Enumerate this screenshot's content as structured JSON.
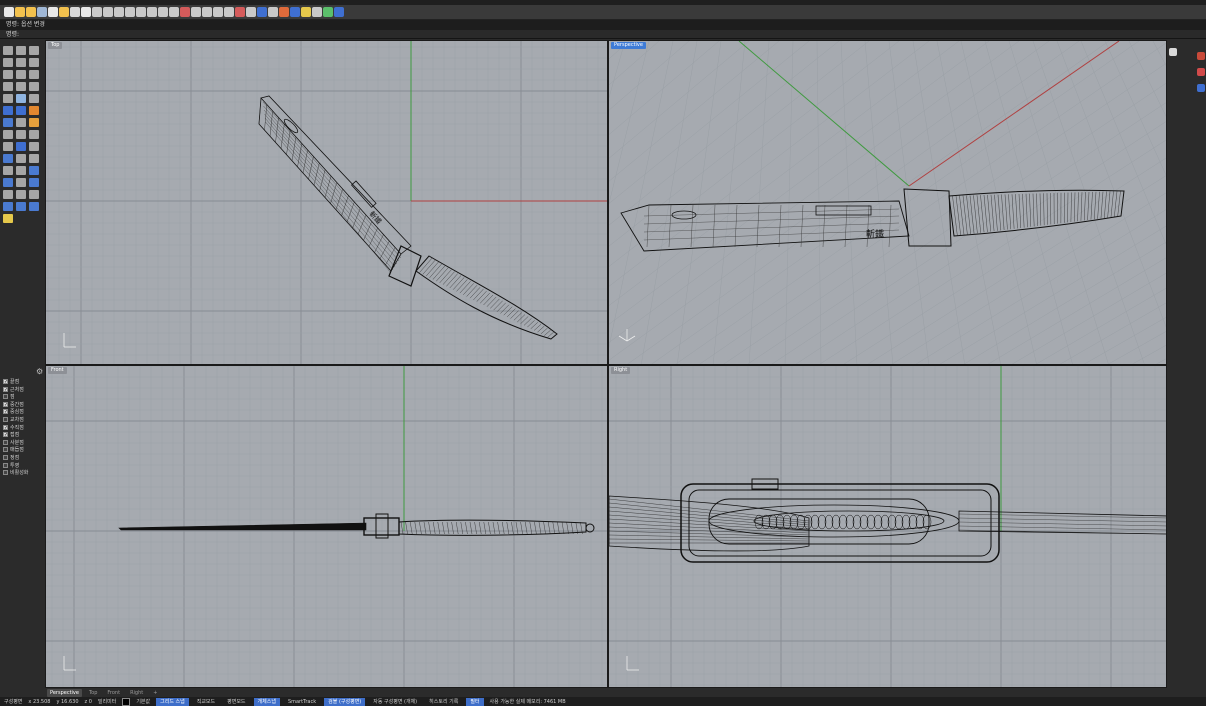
{
  "command_history": "명령: 옵션 변경",
  "command_prompt": "명령:",
  "viewports": {
    "top": "Top",
    "perspective": "Perspective",
    "front": "Front",
    "right": "Right"
  },
  "osnaps": [
    {
      "label": "끝점",
      "on": true
    },
    {
      "label": "근처점",
      "on": true
    },
    {
      "label": "점",
      "on": false
    },
    {
      "label": "중간점",
      "on": true
    },
    {
      "label": "중심점",
      "on": true
    },
    {
      "label": "교차점",
      "on": false
    },
    {
      "label": "수직점",
      "on": true
    },
    {
      "label": "접점",
      "on": true
    },
    {
      "label": "사분점",
      "on": false
    },
    {
      "label": "매듭점",
      "on": false
    },
    {
      "label": "정점",
      "on": false
    },
    {
      "label": "투영",
      "on": false
    },
    {
      "label": "비활성화",
      "on": false
    }
  ],
  "bottom_tabs": [
    "Perspective",
    "Top",
    "Front",
    "Right"
  ],
  "status": {
    "cplane": "구성평면",
    "x": "x 23.508",
    "y": "y 16.630",
    "z": "z 0",
    "units": "밀리미터",
    "layer": "기본값",
    "buttons": [
      {
        "label": "그리드 스냅",
        "on": true
      },
      {
        "label": "직교모드",
        "on": false
      },
      {
        "label": "평면모드",
        "on": false
      },
      {
        "label": "개체스냅",
        "on": true
      },
      {
        "label": "SmartTrack",
        "on": false
      },
      {
        "label": "검볼 (구성평면)",
        "on": true
      },
      {
        "label": "자동 구성평면 (개체)",
        "on": false
      },
      {
        "label": "히스토리 기록",
        "on": false
      },
      {
        "label": "필터",
        "on": true
      }
    ],
    "memory": "사용 가능한 실제 메모리: 7461 MB"
  },
  "label_glyph": "斬鐵",
  "colors": {
    "viewport_bg": "#a6aab0",
    "grid_minor": "#9aa0a6",
    "grid_major": "#878c93",
    "x_axis": "#b04040",
    "y_axis": "#3f9a3f",
    "active_tab": "#3e7bd6",
    "ui_dark": "#2b2b2b"
  }
}
